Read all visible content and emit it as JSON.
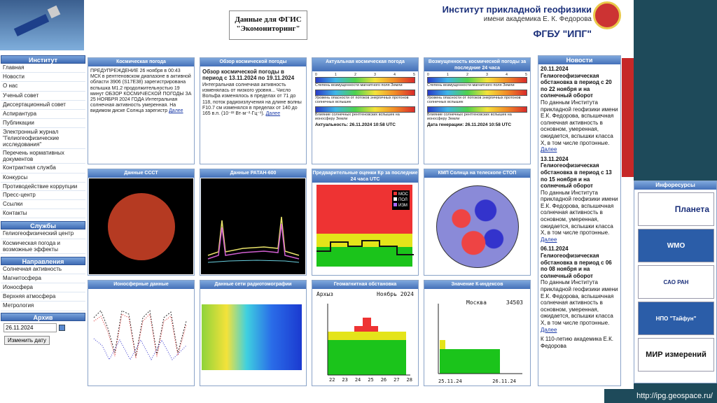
{
  "header": {
    "data_title_1": "Данные для ФГИС",
    "data_title_2": "\"Экомониторинг\"",
    "institute": "Институт прикладной геофизики",
    "institute_sub": "имени академика Е. К. Федорова",
    "fgbu": "ФГБУ \"ИПГ\""
  },
  "sidebar": {
    "institute_head": "Институт",
    "institute_items": [
      "Главная",
      "Новости",
      "О нас",
      "Ученый совет",
      "Диссертационный совет",
      "Аспирантура",
      "Публикации",
      "Электронный журнал \"Гелиогеофизические исследования\"",
      "Перечень нормативных документов",
      "Контрактная служба",
      "Конкурсы",
      "Противодействие коррупции",
      "Пресс-центр",
      "Ссылки",
      "Контакты"
    ],
    "services_head": "Службы",
    "services_items": [
      "Гелиогеофизический центр",
      "Космическая погода и возможные эффекты"
    ],
    "directions_head": "Направления",
    "directions_items": [
      "Солнечная активность",
      "Магнитосфера",
      "Ионосфера",
      "Верхняя атмосфера",
      "Метрология"
    ],
    "archive_head": "Архив",
    "archive_date": "26.11.2024",
    "archive_button": "Изменить дату"
  },
  "panels": {
    "p1_title": "Космическая погода",
    "p1_text": "ПРЕДУПРЕЖДЕНИЕ 26 ноября в 00:43 МСК в рентгеновском диапазоне в активной области 3906 (S17E38) зарегистрирована вспышка М1.2 продолжительностью 19 минут ОБЗОР КОСМИЧЕСКОЙ ПОГОДЫ ЗА 25 НОЯБРЯ 2024 ГОДА Интегральная солнечная активность умеренная. На видимом диске Солнца зарегистр",
    "p1_link": "Далее",
    "p2_title": "Обзор космической погоды",
    "p2_heading": "Обзор космической погоды в период с 13.11.2024 по 19.11.2024",
    "p2_text": "Интегральная солнечная активность изменялась от низкого уровня... Число Вольфа изменялось в пределах от 71 до 118, поток радиоизлучения на длине волны F10.7 см изменялся в пределах от 140 до 165 в.п. (10⁻²² Вт·м⁻²·Гц⁻¹).",
    "p2_link": "Далее",
    "p3_title": "Актуальная космическая погода",
    "p3_band1": "Степень возмущенности магнитного поля Земли",
    "p3_band2": "Уровень опасности от потоков энергичных протонов солнечных вспышек",
    "p3_band3": "Влияние солнечных рентгеновских вспышек на ионосферу Земли",
    "p3_footer": "Актуальность: 26.11.2024 10:58 UTC",
    "p4_title": "Возмущенность космической погоды за последние 24 часа",
    "p4_band1": "Степень возмущенности магнитного поля Земли",
    "p4_band2": "Уровень опасности от потоков энергичных протонов солнечных вспышек",
    "p4_band3": "Влияние солнечных рентгеновских вспышек на ионосферу Земли",
    "p4_footer": "Дата генерации: 26.11.2024 10:58 UTC",
    "p5_title": "Данные СССТ",
    "p6_title": "Данные РАТАН-600",
    "p7_title": "Предварительные оценки Кр за последние 24 часа UTC",
    "p7_legend": [
      "МОС",
      "ПОЛ",
      "ИЗМ"
    ],
    "p8_title": "КМП Солнца на телескопе СТОП",
    "p9_title": "Ионосферные данные",
    "p10_title": "Данные сети радиотомографии",
    "p11_title": "Геомагнитная обстановка",
    "p11_station": "Архыз",
    "p11_month": "Ноябрь 2024",
    "p11_xlabels": [
      "22",
      "23",
      "24",
      "25",
      "26",
      "27",
      "28"
    ],
    "p12_title": "Значение К-индексов",
    "p12_station": "Москва",
    "p12_code": "34503",
    "p12_xlabels": [
      "25.11.24",
      "26.11.24"
    ]
  },
  "scale_ticks": [
    "0",
    "1",
    "2",
    "3",
    "4",
    "5"
  ],
  "news": {
    "head": "Новости",
    "items": [
      {
        "date": "20.11.2024",
        "title": "Гелиогеофизическая обстановка в период с 20 по 22 ноября и на солнечный оборот",
        "text": "По данным Института прикладной геофизики имени Е.К. Федорова, вспышечная солнечная активность в основном, умеренная, ожидается, вспышки класса Х, в том числе протонные."
      },
      {
        "date": "13.11.2024",
        "title": "Гелиогеофизическая обстановка в период с 13 по 15 ноября и на солнечный оборот",
        "text": "По данным Института прикладной геофизики имени Е.К. Федорова, вспышечная солнечная активность в основном, умеренная, ожидается, вспышки класса Х, в том числе протонные."
      },
      {
        "date": "06.11.2024",
        "title": "Гелиогеофизическая обстановка в период с 06 по 08 ноября и на солнечный оборот",
        "text": "По данным Института прикладной геофизики имени Е.К. Федорова, вспышечная солнечная активность в основном, умеренная, ожидается, вспышки класса Х, в том числе протонные."
      }
    ],
    "more_link": "Далее",
    "footer": "К 110-летию академика Е.К. Федорова"
  },
  "infores": {
    "head": "Инфоресурсы",
    "logos": [
      "Планета",
      "WMO",
      "САО РАН",
      "НПО \"Тайфун\"",
      "МИР измерений"
    ]
  },
  "url": "http://ipg.geospace.ru/",
  "colors": {
    "nav_blue": "#4470b8",
    "bg": "#1e4a5a",
    "accent_red": "#c62828",
    "link": "#1a3aa8"
  }
}
